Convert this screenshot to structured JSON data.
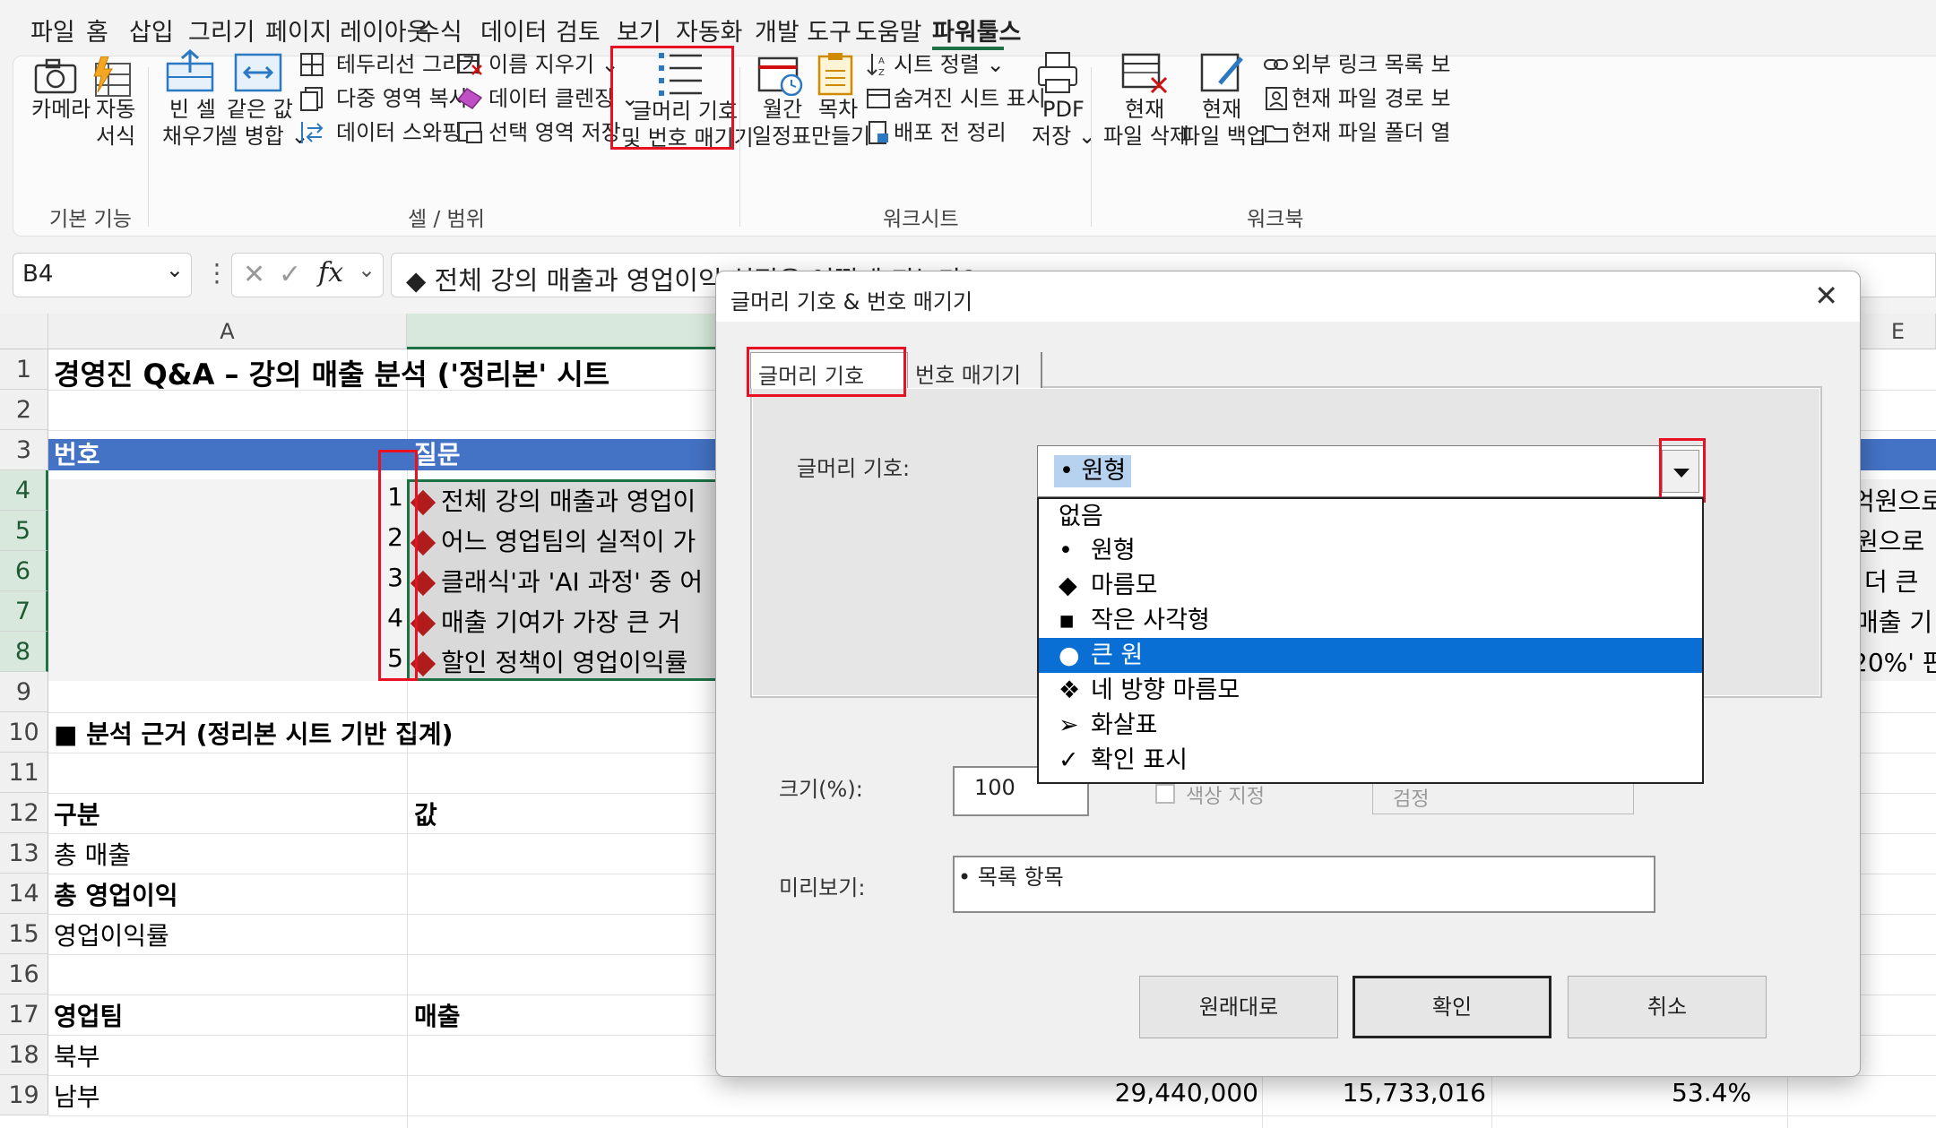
{
  "menu": {
    "tabs": [
      "파일",
      "홈",
      "삽입",
      "그리기",
      "페이지 레이아웃",
      "수식",
      "데이터",
      "검토",
      "보기",
      "자동화",
      "개발 도구",
      "도움말",
      "파워툴스"
    ],
    "active": "파워툴스"
  },
  "ribbon": {
    "camera": "카메라",
    "auto_format_1": "자동",
    "auto_format_2": "서식",
    "fill_blank_1": "빈 셀",
    "fill_blank_2": "채우기",
    "merge_same_1": "같은 값",
    "merge_same_2": "셀 병합 ⌄",
    "border_draw": "테두리선 그리기",
    "multi_copy": "다중 영역 복사",
    "data_swap": "데이터 스와핑",
    "name_clear": "이름 지우기 ⌄",
    "data_clean": "데이터 클렌징 ⌄",
    "save_selection": "선택 영역 저장",
    "bullets_1": "글머리 기호",
    "bullets_2": "및 번호 매기기",
    "monthly_1": "월간",
    "monthly_2": "일정표",
    "toc_1": "목차",
    "toc_2": "만들기",
    "sheet_sort": "시트 정렬 ⌄",
    "hidden_sheet": "숨겨진 시트 표시",
    "pre_dist": "배포 전 정리",
    "pdf_1": "PDF",
    "pdf_2": "저장 ⌄",
    "del_file_1": "현재",
    "del_file_2": "파일 삭제",
    "backup_1": "현재",
    "backup_2": "파일 백업",
    "ext_links": "외부 링크 목록 보",
    "file_path": "현재 파일 경로 보",
    "file_folder": "현재 파일 폴더 열",
    "group_basic": "기본 기능",
    "group_cell": "셀 / 범위",
    "group_sheet": "워크시트",
    "group_book": "워크북"
  },
  "formula_bar": {
    "name_box": "B4",
    "formula": "◆ 전체 강의 매출과 영업이익 실적은 어떻게 되는가?"
  },
  "grid": {
    "col_a": "A",
    "col_e": "E",
    "rows": [
      "1",
      "2",
      "3",
      "4",
      "5",
      "6",
      "7",
      "8",
      "9",
      "10",
      "11",
      "12",
      "13",
      "14",
      "15",
      "16",
      "17",
      "18",
      "19"
    ],
    "title": "경영진 Q&A – 강의 매출 분석 ('정리본' 시트",
    "hdr_no": "번호",
    "hdr_q": "질문",
    "q_nums": [
      "1",
      "2",
      "3",
      "4",
      "5"
    ],
    "q_texts": [
      "전체 강의 매출과 영업이",
      "어느 영업팀의 실적이 가",
      "클래식'과 'AI 과정' 중 어",
      "매출 기여가 가장 큰 거",
      "할인 정책이 영업이익률"
    ],
    "right_texts": [
      "억원으로",
      "원으로",
      "더 큰",
      "매출 기",
      "20%' 판"
    ],
    "basis": "■ 분석 근거 (정리본 시트 기반 집계)",
    "hdr_kind": "구분",
    "hdr_val": "값",
    "total_sales": "총 매출",
    "total_profit": "총 영업이익",
    "profit_rate": "영업이익률",
    "hdr_team": "영업팀",
    "hdr_sales": "매출",
    "team_north": "북부",
    "team_south": "남부",
    "south_sales": "29,440,000",
    "south_profit": "15,733,016",
    "south_rate": "53.4%"
  },
  "dialog": {
    "title": "글머리 기호 & 번호 매기기",
    "close": "✕",
    "tab_bullets": "글머리 기호",
    "tab_numbering": "번호 매기기",
    "bullet_label": "글머리 기호:",
    "selected": "•  원형",
    "options": [
      {
        "glyph": "",
        "label": "없음"
      },
      {
        "glyph": "•",
        "label": "원형"
      },
      {
        "glyph": "◆",
        "label": "마름모"
      },
      {
        "glyph": "▪",
        "label": "작은 사각형"
      },
      {
        "glyph": "●",
        "label": "큰 원"
      },
      {
        "glyph": "❖",
        "label": "네 방향 마름모"
      },
      {
        "glyph": "➢",
        "label": "화살표"
      },
      {
        "glyph": "✓",
        "label": "확인 표시"
      }
    ],
    "highlighted_index": 4,
    "size_label": "크기(%):",
    "size_value": "100",
    "color_check": "색상 지정",
    "color_value": "검정",
    "preview_label": "미리보기:",
    "preview_text": "•  목록 항목",
    "btn_reset": "원래대로",
    "btn_ok": "확인",
    "btn_cancel": "취소"
  },
  "colors": {
    "excel_green": "#1e7145",
    "header_blue": "#4472c4",
    "highlight_blue": "#0a6fd4",
    "annotation_red": "#e81123",
    "diamond_red": "#b01c1c"
  }
}
